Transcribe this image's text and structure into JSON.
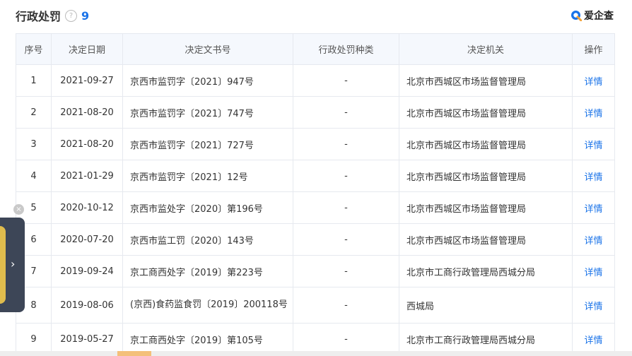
{
  "header": {
    "title": "行政处罚",
    "help_icon": "?",
    "count": "9"
  },
  "brand": {
    "name": "爱企查"
  },
  "table": {
    "columns": [
      "序号",
      "决定日期",
      "决定文书号",
      "行政处罚种类",
      "决定机关",
      "操作"
    ],
    "rows": [
      {
        "no": "1",
        "date": "2021-09-27",
        "doc": "京西市监罚字〔2021〕947号",
        "type": "-",
        "org": "北京市西城区市场监督管理局",
        "action": "详情"
      },
      {
        "no": "2",
        "date": "2021-08-20",
        "doc": "京西市监罚字〔2021〕747号",
        "type": "-",
        "org": "北京市西城区市场监督管理局",
        "action": "详情"
      },
      {
        "no": "3",
        "date": "2021-08-20",
        "doc": "京西市监罚字〔2021〕727号",
        "type": "-",
        "org": "北京市西城区市场监督管理局",
        "action": "详情"
      },
      {
        "no": "4",
        "date": "2021-01-29",
        "doc": "京西市监罚字〔2021〕12号",
        "type": "-",
        "org": "北京市西城区市场监督管理局",
        "action": "详情"
      },
      {
        "no": "5",
        "date": "2020-10-12",
        "doc": "京西市监处字〔2020〕第196号",
        "type": "-",
        "org": "北京市西城区市场监督管理局",
        "action": "详情"
      },
      {
        "no": "6",
        "date": "2020-07-20",
        "doc": "京西市监工罚〔2020〕143号",
        "type": "-",
        "org": "北京市西城区市场监督管理局",
        "action": "详情"
      },
      {
        "no": "7",
        "date": "2019-09-24",
        "doc": "京工商西处字〔2019〕第223号",
        "type": "-",
        "org": "北京市工商行政管理局西城分局",
        "action": "详情"
      },
      {
        "no": "8",
        "date": "2019-08-06",
        "doc": "(京西)食药监食罚〔2019〕200118号",
        "type": "-",
        "org": "西城局",
        "action": "详情"
      },
      {
        "no": "9",
        "date": "2019-05-27",
        "doc": "京工商西处字〔2019〕第105号",
        "type": "-",
        "org": "北京市工商行政管理局西城分局",
        "action": "详情"
      }
    ]
  },
  "side_panel": {
    "arrow": "›",
    "close": "×"
  }
}
